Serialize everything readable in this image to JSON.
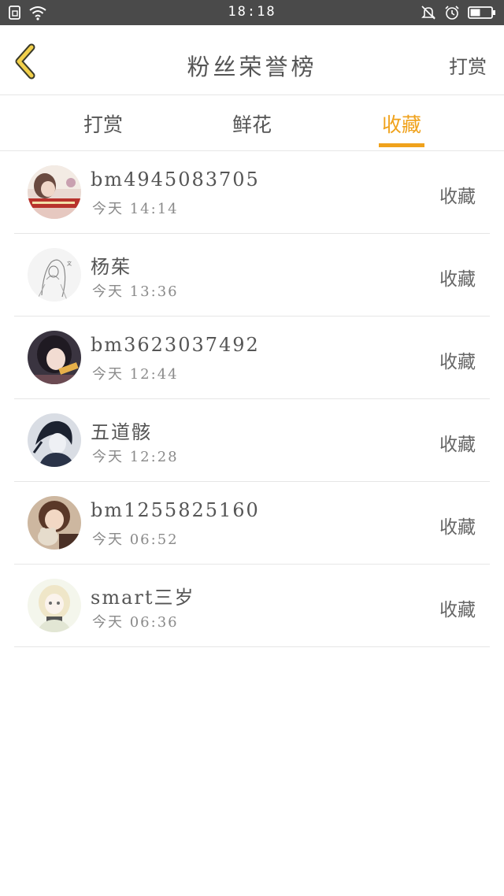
{
  "status_bar": {
    "time": "18:18",
    "icons": [
      "sim-card-icon",
      "wifi-icon",
      "bell-off-icon",
      "alarm-clock-icon",
      "battery-icon"
    ]
  },
  "header": {
    "title": "粉丝荣誉榜",
    "action_label": "打赏",
    "back_icon": "chevron-left-icon"
  },
  "tabs": [
    {
      "label": "打赏",
      "active": false
    },
    {
      "label": "鲜花",
      "active": false
    },
    {
      "label": "收藏",
      "active": true
    }
  ],
  "colors": {
    "accent": "#f0a21c",
    "status_bar_bg": "#4a4a4a",
    "divider": "#e6e6e6",
    "text": "#555555"
  },
  "rows": [
    {
      "username": "bm4945083705",
      "timestamp": "今天 14:14",
      "action": "收藏"
    },
    {
      "username": "杨茱",
      "timestamp": "今天 13:36",
      "action": "收藏"
    },
    {
      "username": "bm3623037492",
      "timestamp": "今天 12:44",
      "action": "收藏"
    },
    {
      "username": "五道骸",
      "timestamp": "今天 12:28",
      "action": "收藏"
    },
    {
      "username": "bm1255825160",
      "timestamp": "今天 06:52",
      "action": "收藏"
    },
    {
      "username": "smart三岁",
      "timestamp": "今天 06:36",
      "action": "收藏"
    }
  ]
}
